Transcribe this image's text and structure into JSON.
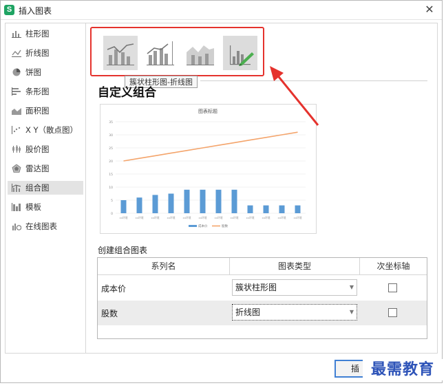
{
  "window": {
    "app_icon_letter": "S",
    "title": "插入图表"
  },
  "sidebar": {
    "items": [
      {
        "label": "柱形图",
        "icon": "column-chart-icon"
      },
      {
        "label": "折线图",
        "icon": "line-chart-icon"
      },
      {
        "label": "饼图",
        "icon": "pie-chart-icon"
      },
      {
        "label": "条形图",
        "icon": "bar-chart-icon"
      },
      {
        "label": "面积图",
        "icon": "area-chart-icon"
      },
      {
        "label": "X Y（散点图）",
        "icon": "scatter-chart-icon"
      },
      {
        "label": "股价图",
        "icon": "stock-chart-icon"
      },
      {
        "label": "雷达图",
        "icon": "radar-chart-icon"
      },
      {
        "label": "组合图",
        "icon": "combo-chart-icon",
        "selected": true
      },
      {
        "label": "模板",
        "icon": "template-icon"
      },
      {
        "label": "在线图表",
        "icon": "online-chart-icon"
      }
    ]
  },
  "subtypes": {
    "items": [
      "clustered-column-line-icon",
      "clustered-column-line-secondary-axis-icon",
      "stacked-area-clustered-column-icon",
      "custom-combo-icon"
    ],
    "selected_index": 3,
    "tooltip": "簇状柱形图-折线图"
  },
  "section_title": "自定义组合",
  "preview": {
    "chart_data": {
      "type": "bar",
      "title": "图表标题",
      "categories": [
        "xx环境",
        "xx环境",
        "xx环境",
        "xx环境",
        "xx环境",
        "xx环境",
        "xx环境",
        "xx环境",
        "xx环境",
        "xx环境",
        "xx环境",
        "xx环境"
      ],
      "yticks": [
        "0",
        "5",
        "10",
        "15",
        "20",
        "25",
        "30",
        "35"
      ],
      "ylim": [
        0,
        35
      ],
      "series": [
        {
          "name": "成本价",
          "type": "bar",
          "color": "#5b9bd5",
          "values": [
            5,
            6,
            7,
            7.5,
            9,
            9,
            9,
            9,
            3,
            3,
            3,
            3
          ]
        },
        {
          "name": "股数",
          "type": "line",
          "color": "#f4a46b",
          "values": [
            20,
            21,
            22,
            23,
            24,
            25,
            26,
            27,
            28,
            29,
            30,
            31
          ]
        }
      ],
      "legend": "bottom"
    }
  },
  "create_combo_label": "创建组合图表",
  "table": {
    "headers": [
      "系列名",
      "图表类型",
      "次坐标轴"
    ],
    "rows": [
      {
        "series": "成本价",
        "chart_type": "簇状柱形图",
        "secondary_axis": false
      },
      {
        "series": "股数",
        "chart_type": "折线图",
        "secondary_axis": false
      }
    ]
  },
  "buttons": {
    "insert": "插入"
  },
  "watermark": "最需教育",
  "colors": {
    "highlight_box": "#e5322d",
    "bar": "#5b9bd5",
    "line": "#f4a46b",
    "check_accent": "#4caf50"
  }
}
